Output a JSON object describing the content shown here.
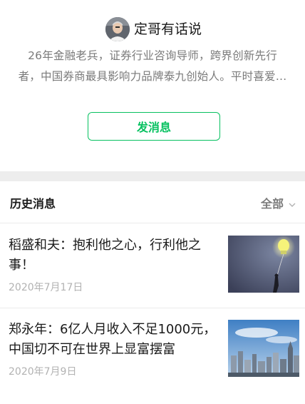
{
  "profile": {
    "account_name": "定哥有话说",
    "bio_line1": "26年金融老兵，证券行业咨询导师，跨界创新先行",
    "bio_line2": "者，中国券商最具影响力品牌泰九创始人。平时喜爱…",
    "send_button_label": "发消息"
  },
  "history": {
    "title": "历史消息",
    "filter_label": "全部",
    "articles": [
      {
        "title": "稻盛和夫：抱利他之心，行利他之事！",
        "date": "2020年7月17日",
        "thumbnail": "lightbulb-balloon-image"
      },
      {
        "title": "郑永年：6亿人月收入不足1000元，中国切不可在世界上显富摆富",
        "date": "2020年7月9日",
        "thumbnail": "city-skyline-image"
      }
    ]
  }
}
